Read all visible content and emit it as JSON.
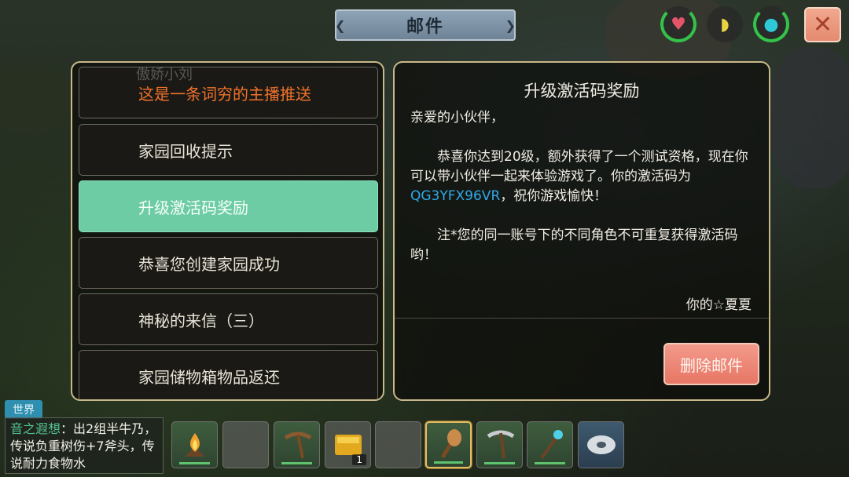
{
  "header": {
    "title": "邮件",
    "close_label": "✕"
  },
  "status_icons": [
    {
      "name": "health",
      "glyph": "♥",
      "color": "#e4556a",
      "ring": "#34c24a"
    },
    {
      "name": "hunger",
      "glyph": "◗",
      "color": "#e8d443",
      "ring": "none"
    },
    {
      "name": "water",
      "glyph": "●",
      "color": "#2ec8d6",
      "ring": "#34c24a"
    }
  ],
  "mail_list": [
    {
      "label": "这是一条词穷的主播推送",
      "type": "notice"
    },
    {
      "label": "家园回收提示",
      "type": "normal"
    },
    {
      "label": "升级激活码奖励",
      "type": "selected"
    },
    {
      "label": "恭喜您创建家园成功",
      "type": "normal"
    },
    {
      "label": "神秘的来信（三）",
      "type": "normal"
    },
    {
      "label": "家园储物箱物品返还",
      "type": "normal"
    }
  ],
  "ghost_text": "傲娇小刘",
  "message": {
    "title": "升级激活码奖励",
    "greeting": "亲爱的小伙伴，",
    "para1": "　　恭喜你达到20级，额外获得了一个测试资格，现在你可以带小伙伴一起来体验游戏了。你的激活码为",
    "code": "QG3YFX96VR",
    "para1_end": "，祝你游戏愉快！",
    "note": "　　注*您的同一账号下的不同角色不可重复获得激活码哟！",
    "signature": "你的☆夏夏",
    "delete_label": "删除邮件"
  },
  "chat": {
    "channel": "世界",
    "sender": "音之遐想",
    "text": "：出2组半牛乃，传说负重树伤+7斧头，传说耐力食物水"
  },
  "hotbar": [
    {
      "icon": "campfire-icon",
      "kind": "item",
      "count": ""
    },
    {
      "icon": "empty-slot",
      "kind": "empty",
      "count": ""
    },
    {
      "icon": "pickaxe-icon",
      "kind": "item",
      "count": ""
    },
    {
      "icon": "gold-ingot-icon",
      "kind": "empty",
      "count": "1"
    },
    {
      "icon": "empty-slot",
      "kind": "empty",
      "count": ""
    },
    {
      "icon": "club-icon",
      "kind": "selected",
      "count": ""
    },
    {
      "icon": "iron-pickaxe-icon",
      "kind": "item",
      "count": ""
    },
    {
      "icon": "magic-staff-icon",
      "kind": "item",
      "count": ""
    },
    {
      "icon": "stone-disc-icon",
      "kind": "blue",
      "count": ""
    }
  ]
}
